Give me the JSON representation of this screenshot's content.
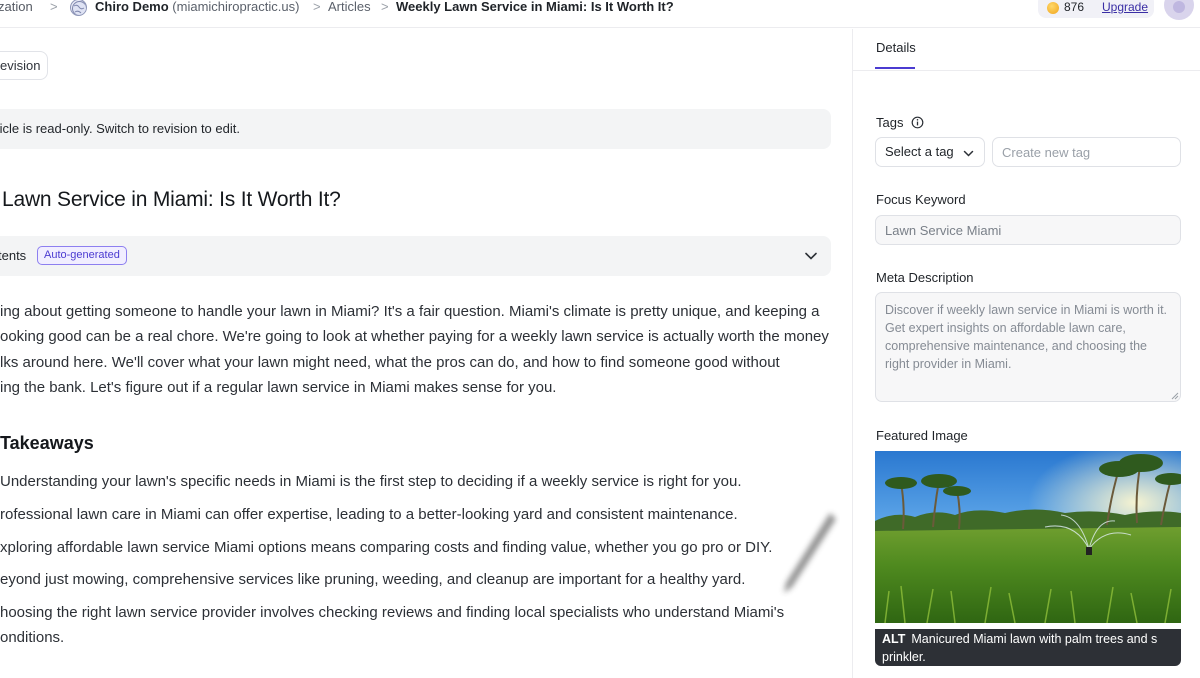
{
  "breadcrumb": {
    "org": "zation",
    "separator": ">",
    "site_name": "Chiro Demo",
    "site_domain": "(miamichiropractic.us)",
    "articles": "Articles",
    "current": "Weekly Lawn Service in Miami: Is It Worth It?"
  },
  "account": {
    "credits": "876",
    "upgrade_label": "Upgrade"
  },
  "main": {
    "revision_button": "evision",
    "notice": "ticle is read-only. Switch to revision to edit.",
    "title": "Lawn Service in Miami: Is It Worth It?",
    "toc": {
      "label": "tents",
      "badge": "Auto-generated"
    },
    "intro_lines": [
      "ing about getting someone to handle your lawn in Miami? It's a fair question. Miami's climate is pretty unique, and keeping a",
      "ooking good can be a real chore. We're going to look at whether paying for a weekly lawn service is actually worth the money",
      "lks around here. We'll cover what your lawn might need, what the pros can do, and how to find someone good without",
      "ing the bank. Let's figure out if a regular lawn service in Miami makes sense for you."
    ],
    "takeaways_heading": "Takeaways",
    "takeaways": [
      "Understanding your lawn's specific needs in Miami is the first step to deciding if a weekly service is right for you.",
      "rofessional lawn care in Miami can offer expertise, leading to a better-looking yard and consistent maintenance.",
      "xploring affordable lawn service Miami options means comparing costs and finding value, whether you go pro or DIY.",
      "eyond just mowing, comprehensive services like pruning, weeding, and cleanup are important for a healthy yard.",
      "hoosing the right lawn service provider involves checking reviews and finding local specialists who understand Miami's",
      "onditions."
    ]
  },
  "panel": {
    "tab_details": "Details",
    "tags_label": "Tags",
    "tag_select": "Select a tag",
    "tag_input_placeholder": "Create new tag",
    "focus_keyword_label": "Focus Keyword",
    "focus_keyword_value": "Lawn Service Miami",
    "meta_label": "Meta Description",
    "meta_value": "Discover if weekly lawn service in Miami is worth it. Get expert insights on affordable lawn care, comprehensive maintenance, and choosing the right provider in Miami.",
    "featured_image_label": "Featured Image",
    "alt_tag": "ALT",
    "alt_text": "Manicured Miami lawn with palm trees and s prinkler."
  },
  "icons": {
    "globe": "globe-icon",
    "chevron": "chevron-down-icon",
    "info": "info-icon",
    "coin": "coin-icon"
  }
}
